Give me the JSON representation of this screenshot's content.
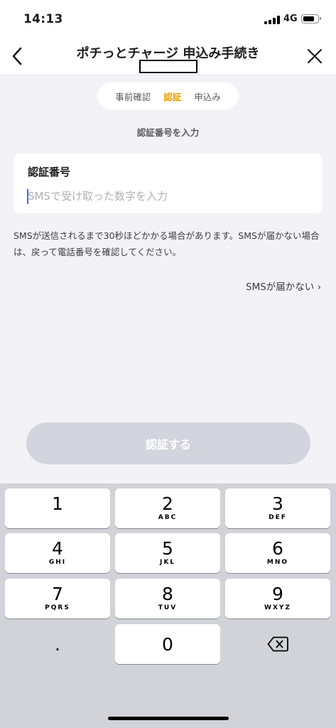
{
  "status": {
    "time": "14:13",
    "network": "4G"
  },
  "nav": {
    "title": "ポチっとチャージ 申込み手続き",
    "back_icon": "chevron-left-icon",
    "close_icon": "close-icon"
  },
  "steps": [
    {
      "label": "事前確認",
      "active": false
    },
    {
      "label": "認証",
      "active": true
    },
    {
      "label": "申込み",
      "active": false
    }
  ],
  "section_label": "認証番号を入力",
  "form": {
    "label": "認証番号",
    "value": "",
    "placeholder": "SMSで受け取った数字を入力"
  },
  "note": "SMSが送信されるまで30秒ほどかかる場合があります。SMSが届かない場合は、戻って電話番号を確認してください。",
  "sms_link": "SMSが届かない ›",
  "verify_button": "認証する",
  "colors": {
    "accent": "#e6a000",
    "button_disabled": "#d3d5de",
    "caret": "#3f6fe0",
    "background": "#f3f3f7"
  },
  "keypad": {
    "keys": [
      {
        "digit": "1",
        "letters": ""
      },
      {
        "digit": "2",
        "letters": "ABC"
      },
      {
        "digit": "3",
        "letters": "DEF"
      },
      {
        "digit": "4",
        "letters": "GHI"
      },
      {
        "digit": "5",
        "letters": "JKL"
      },
      {
        "digit": "6",
        "letters": "MNO"
      },
      {
        "digit": "7",
        "letters": "PQRS"
      },
      {
        "digit": "8",
        "letters": "TUV"
      },
      {
        "digit": "9",
        "letters": "WXYZ"
      }
    ],
    "dot": ".",
    "zero": "0",
    "delete_icon": "backspace-icon"
  }
}
